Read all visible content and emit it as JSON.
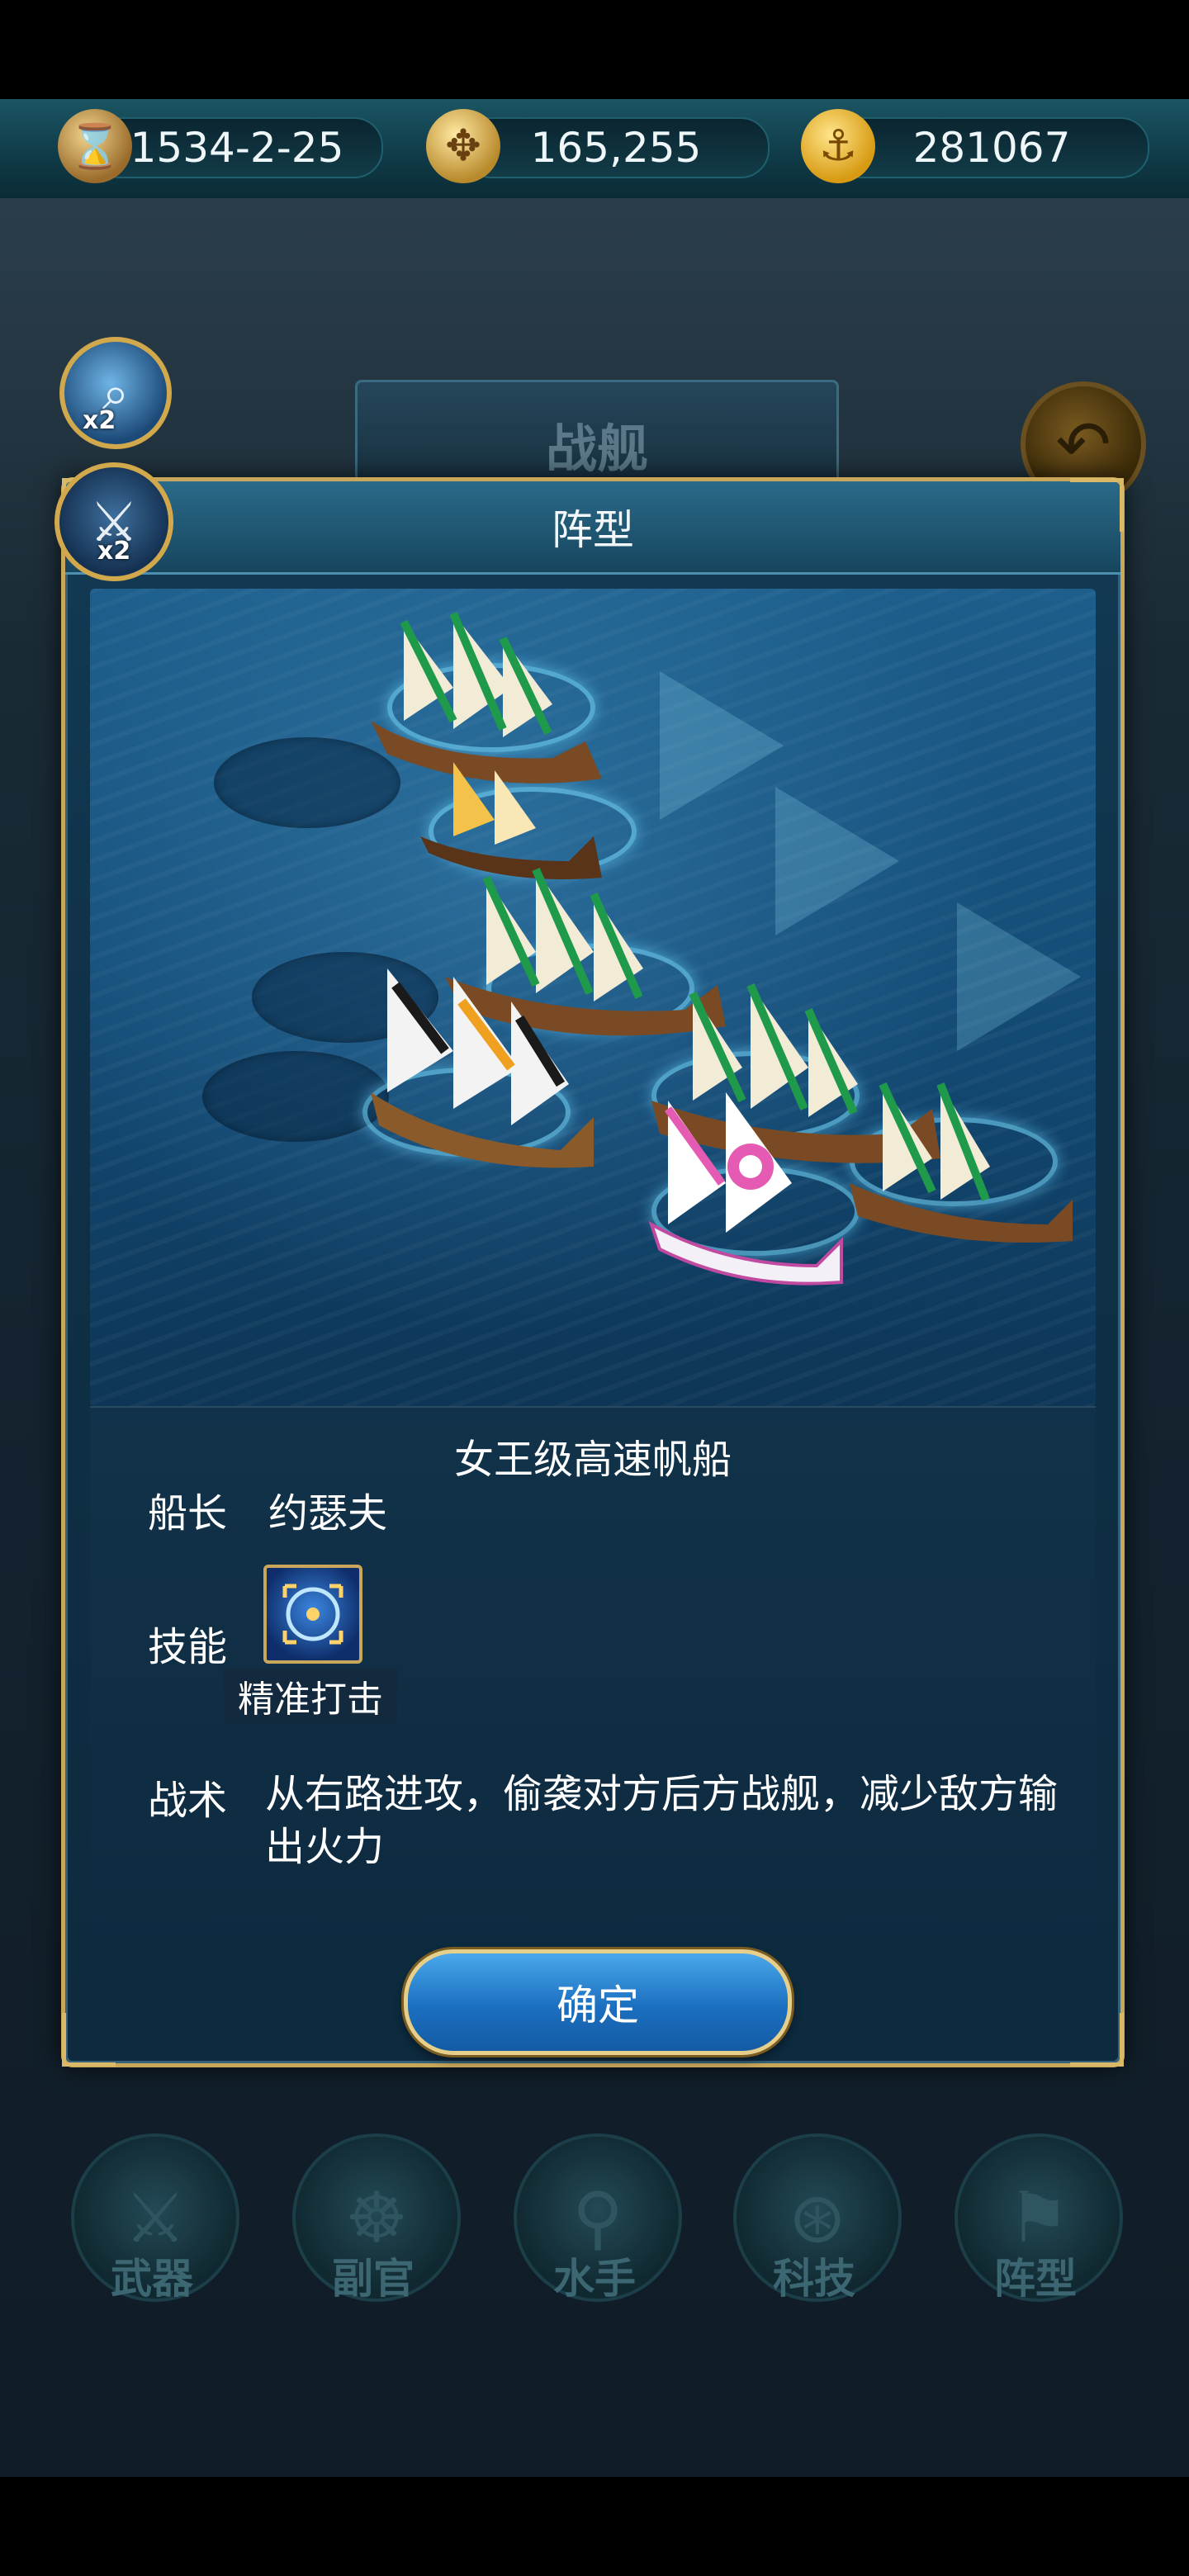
{
  "resources": {
    "date": "1534-2-25",
    "silver": "165,255",
    "gold": "281067"
  },
  "icons": {
    "date": "hourglass-icon",
    "silver": "compass-coin-icon",
    "gold": "anchor-coin-icon",
    "magnifier": "magnifier-icon",
    "swords": "crossed-swords-icon",
    "back": "back-arrow-icon"
  },
  "boosts": {
    "magnifier_badge": "x2",
    "swords_badge": "x2"
  },
  "background": {
    "title": "战舰",
    "nav": [
      {
        "label": "武器",
        "icon": "sword-icon"
      },
      {
        "label": "副官",
        "icon": "ship-wheel-icon"
      },
      {
        "label": "水手",
        "icon": "hook-icon"
      },
      {
        "label": "科技",
        "icon": "compass-icon"
      },
      {
        "label": "阵型",
        "icon": "flag-icon"
      }
    ]
  },
  "dialog": {
    "title": "阵型",
    "ship_name": "女王级高速帆船",
    "captain_label": "船长",
    "captain_value": "约瑟夫",
    "skill_label": "技能",
    "skill_name": "精准打击",
    "tactic_label": "战术",
    "tactic_text": "从右路进攻，偷袭对方后方战舰，减少敌方输出火力",
    "confirm": "确定"
  },
  "colors": {
    "accent_gold": "#c9a75a",
    "button_blue": "#1b6fc0",
    "sea_blue": "#134a74"
  }
}
